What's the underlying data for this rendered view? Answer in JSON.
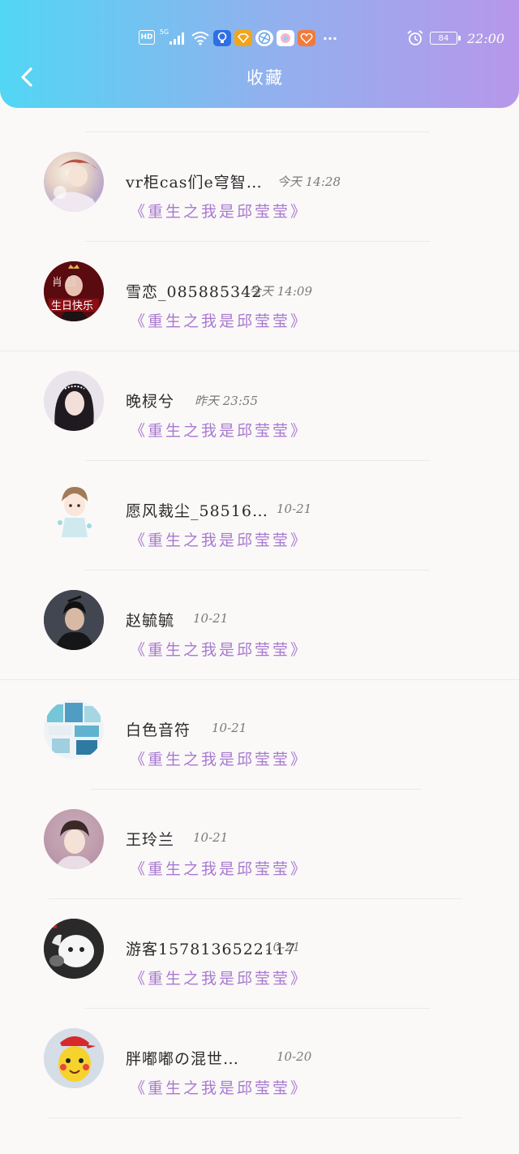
{
  "status_bar": {
    "hd": "HD",
    "network": "5G",
    "battery": "84",
    "time": "22:00",
    "more": "···",
    "icons": [
      "hd-icon",
      "signal-icon",
      "wifi-icon",
      "bulb-app-icon",
      "diamond-app-icon",
      "browser-app-icon",
      "circle-app-icon",
      "heart-app-icon",
      "more-icon",
      "alarm-icon",
      "battery-icon"
    ]
  },
  "header": {
    "title": "收藏",
    "back_icon": "chevron-left-icon"
  },
  "colors": {
    "gradient_start": "#52d6f4",
    "gradient_end": "#b797ea",
    "book_title": "#a77ad0"
  },
  "items": [
    {
      "name": "vr柜cas们e穹智…",
      "time": "今天 14:28",
      "book": "《重生之我是邱莹莹》"
    },
    {
      "name": "雪恋_085885342",
      "time": "今天 14:09",
      "book": "《重生之我是邱莹莹》",
      "avatar_text_top": "肖  战",
      "avatar_text_bottom": "生日快乐"
    },
    {
      "name": "晚棂兮",
      "time": "昨天 23:55",
      "book": "《重生之我是邱莹莹》"
    },
    {
      "name": "愿风裁尘_58516…",
      "time": "10-21",
      "book": "《重生之我是邱莹莹》"
    },
    {
      "name": "赵毓毓",
      "time": "10-21",
      "book": "《重生之我是邱莹莹》"
    },
    {
      "name": "白色音符",
      "time": "10-21",
      "book": "《重生之我是邱莹莹》"
    },
    {
      "name": "王玲兰",
      "time": "10-21",
      "book": "《重生之我是邱莹莹》"
    },
    {
      "name": "游客1578136522117",
      "time": "10-21",
      "book": "《重生之我是邱莹莹》"
    },
    {
      "name": "胖嘟嘟の混世…",
      "time": "10-20",
      "book": "《重生之我是邱莹莹》"
    }
  ]
}
